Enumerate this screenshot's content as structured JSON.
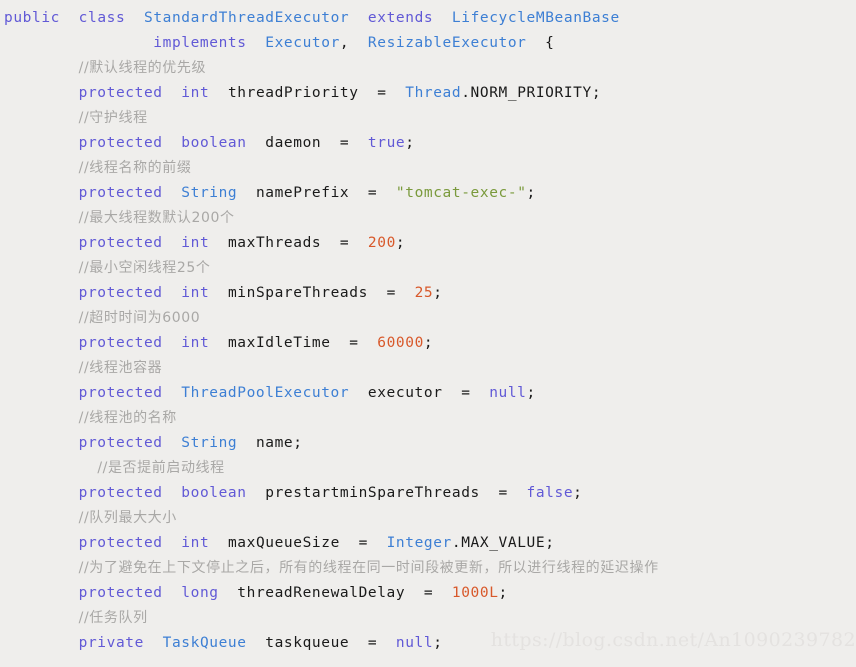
{
  "editor": {
    "background_color": "#efeeec",
    "language": "java",
    "colors": {
      "keyword": "#6159d6",
      "type": "#3d7fd4",
      "identifier": "#1a1a1a",
      "number": "#d8582a",
      "string": "#7a9a3c",
      "comment": "#a9a8a6"
    }
  },
  "watermark": {
    "text": "https://blog.csdn.net/An1090239782"
  },
  "code": {
    "lines": [
      {
        "id": "line-1",
        "tokens": [
          {
            "t": "public",
            "c": "kw"
          },
          {
            "t": "  ",
            "c": "punc"
          },
          {
            "t": "class",
            "c": "kw"
          },
          {
            "t": "  ",
            "c": "punc"
          },
          {
            "t": "StandardThreadExecutor",
            "c": "type"
          },
          {
            "t": "  ",
            "c": "punc"
          },
          {
            "t": "extends",
            "c": "kw"
          },
          {
            "t": "  ",
            "c": "punc"
          },
          {
            "t": "LifecycleMBeanBase",
            "c": "type"
          }
        ]
      },
      {
        "id": "line-2",
        "tokens": [
          {
            "t": "                ",
            "c": "punc"
          },
          {
            "t": "implements",
            "c": "kw"
          },
          {
            "t": "  ",
            "c": "punc"
          },
          {
            "t": "Executor",
            "c": "type"
          },
          {
            "t": ",  ",
            "c": "punc"
          },
          {
            "t": "ResizableExecutor",
            "c": "type"
          },
          {
            "t": "  {",
            "c": "punc"
          }
        ]
      },
      {
        "id": "line-3",
        "tokens": [
          {
            "t": "        ",
            "c": "punc"
          },
          {
            "t": "//默认线程的优先级",
            "c": "cmt"
          }
        ]
      },
      {
        "id": "line-4",
        "tokens": [
          {
            "t": "        ",
            "c": "punc"
          },
          {
            "t": "protected",
            "c": "kw"
          },
          {
            "t": "  ",
            "c": "punc"
          },
          {
            "t": "int",
            "c": "kw"
          },
          {
            "t": "  ",
            "c": "punc"
          },
          {
            "t": "threadPriority",
            "c": "id"
          },
          {
            "t": "  =  ",
            "c": "punc"
          },
          {
            "t": "Thread",
            "c": "type"
          },
          {
            "t": ".NORM_PRIORITY;",
            "c": "id"
          }
        ]
      },
      {
        "id": "line-5",
        "tokens": [
          {
            "t": "        ",
            "c": "punc"
          },
          {
            "t": "//守护线程",
            "c": "cmt"
          }
        ]
      },
      {
        "id": "line-6",
        "tokens": [
          {
            "t": "        ",
            "c": "punc"
          },
          {
            "t": "protected",
            "c": "kw"
          },
          {
            "t": "  ",
            "c": "punc"
          },
          {
            "t": "boolean",
            "c": "kw"
          },
          {
            "t": "  ",
            "c": "punc"
          },
          {
            "t": "daemon",
            "c": "id"
          },
          {
            "t": "  =  ",
            "c": "punc"
          },
          {
            "t": "true",
            "c": "kw"
          },
          {
            "t": ";",
            "c": "punc"
          }
        ]
      },
      {
        "id": "line-7",
        "tokens": [
          {
            "t": "        ",
            "c": "punc"
          },
          {
            "t": "//线程名称的前缀",
            "c": "cmt"
          }
        ]
      },
      {
        "id": "line-8",
        "tokens": [
          {
            "t": "        ",
            "c": "punc"
          },
          {
            "t": "protected",
            "c": "kw"
          },
          {
            "t": "  ",
            "c": "punc"
          },
          {
            "t": "String",
            "c": "type"
          },
          {
            "t": "  ",
            "c": "punc"
          },
          {
            "t": "namePrefix",
            "c": "id"
          },
          {
            "t": "  =  ",
            "c": "punc"
          },
          {
            "t": "\"tomcat-exec-\"",
            "c": "str"
          },
          {
            "t": ";",
            "c": "punc"
          }
        ]
      },
      {
        "id": "line-9",
        "tokens": [
          {
            "t": "        ",
            "c": "punc"
          },
          {
            "t": "//最大线程数默认200个",
            "c": "cmt"
          }
        ]
      },
      {
        "id": "line-10",
        "tokens": [
          {
            "t": "        ",
            "c": "punc"
          },
          {
            "t": "protected",
            "c": "kw"
          },
          {
            "t": "  ",
            "c": "punc"
          },
          {
            "t": "int",
            "c": "kw"
          },
          {
            "t": "  ",
            "c": "punc"
          },
          {
            "t": "maxThreads",
            "c": "id"
          },
          {
            "t": "  =  ",
            "c": "punc"
          },
          {
            "t": "200",
            "c": "num"
          },
          {
            "t": ";",
            "c": "punc"
          }
        ]
      },
      {
        "id": "line-11",
        "tokens": [
          {
            "t": "        ",
            "c": "punc"
          },
          {
            "t": "//最小空闲线程25个",
            "c": "cmt"
          }
        ]
      },
      {
        "id": "line-12",
        "tokens": [
          {
            "t": "        ",
            "c": "punc"
          },
          {
            "t": "protected",
            "c": "kw"
          },
          {
            "t": "  ",
            "c": "punc"
          },
          {
            "t": "int",
            "c": "kw"
          },
          {
            "t": "  ",
            "c": "punc"
          },
          {
            "t": "minSpareThreads",
            "c": "id"
          },
          {
            "t": "  =  ",
            "c": "punc"
          },
          {
            "t": "25",
            "c": "num"
          },
          {
            "t": ";",
            "c": "punc"
          }
        ]
      },
      {
        "id": "line-13",
        "tokens": [
          {
            "t": "        ",
            "c": "punc"
          },
          {
            "t": "//超时时间为6000",
            "c": "cmt"
          }
        ]
      },
      {
        "id": "line-14",
        "tokens": [
          {
            "t": "        ",
            "c": "punc"
          },
          {
            "t": "protected",
            "c": "kw"
          },
          {
            "t": "  ",
            "c": "punc"
          },
          {
            "t": "int",
            "c": "kw"
          },
          {
            "t": "  ",
            "c": "punc"
          },
          {
            "t": "maxIdleTime",
            "c": "id"
          },
          {
            "t": "  =  ",
            "c": "punc"
          },
          {
            "t": "60000",
            "c": "num"
          },
          {
            "t": ";",
            "c": "punc"
          }
        ]
      },
      {
        "id": "line-15",
        "tokens": [
          {
            "t": "        ",
            "c": "punc"
          },
          {
            "t": "//线程池容器",
            "c": "cmt"
          }
        ]
      },
      {
        "id": "line-16",
        "tokens": [
          {
            "t": "        ",
            "c": "punc"
          },
          {
            "t": "protected",
            "c": "kw"
          },
          {
            "t": "  ",
            "c": "punc"
          },
          {
            "t": "ThreadPoolExecutor",
            "c": "type"
          },
          {
            "t": "  ",
            "c": "punc"
          },
          {
            "t": "executor",
            "c": "id"
          },
          {
            "t": "  =  ",
            "c": "punc"
          },
          {
            "t": "null",
            "c": "kw"
          },
          {
            "t": ";",
            "c": "punc"
          }
        ]
      },
      {
        "id": "line-17",
        "tokens": [
          {
            "t": "        ",
            "c": "punc"
          },
          {
            "t": "//线程池的名称",
            "c": "cmt"
          }
        ]
      },
      {
        "id": "line-18",
        "tokens": [
          {
            "t": "        ",
            "c": "punc"
          },
          {
            "t": "protected",
            "c": "kw"
          },
          {
            "t": "  ",
            "c": "punc"
          },
          {
            "t": "String",
            "c": "type"
          },
          {
            "t": "  ",
            "c": "punc"
          },
          {
            "t": "name",
            "c": "id"
          },
          {
            "t": ";",
            "c": "punc"
          }
        ]
      },
      {
        "id": "line-19",
        "tokens": [
          {
            "t": "          ",
            "c": "punc"
          },
          {
            "t": "//是否提前启动线程",
            "c": "cmt"
          }
        ]
      },
      {
        "id": "line-20",
        "tokens": [
          {
            "t": "        ",
            "c": "punc"
          },
          {
            "t": "protected",
            "c": "kw"
          },
          {
            "t": "  ",
            "c": "punc"
          },
          {
            "t": "boolean",
            "c": "kw"
          },
          {
            "t": "  ",
            "c": "punc"
          },
          {
            "t": "prestartminSpareThreads",
            "c": "id"
          },
          {
            "t": "  =  ",
            "c": "punc"
          },
          {
            "t": "false",
            "c": "kw"
          },
          {
            "t": ";",
            "c": "punc"
          }
        ]
      },
      {
        "id": "line-21",
        "tokens": [
          {
            "t": "        ",
            "c": "punc"
          },
          {
            "t": "//队列最大大小",
            "c": "cmt"
          }
        ]
      },
      {
        "id": "line-22",
        "tokens": [
          {
            "t": "        ",
            "c": "punc"
          },
          {
            "t": "protected",
            "c": "kw"
          },
          {
            "t": "  ",
            "c": "punc"
          },
          {
            "t": "int",
            "c": "kw"
          },
          {
            "t": "  ",
            "c": "punc"
          },
          {
            "t": "maxQueueSize",
            "c": "id"
          },
          {
            "t": "  =  ",
            "c": "punc"
          },
          {
            "t": "Integer",
            "c": "type"
          },
          {
            "t": ".MAX_VALUE;",
            "c": "id"
          }
        ]
      },
      {
        "id": "line-23",
        "tokens": [
          {
            "t": "        ",
            "c": "punc"
          },
          {
            "t": "//为了避免在上下文停止之后，所有的线程在同一时间段被更新，所以进行线程的延迟操作",
            "c": "cmt"
          }
        ]
      },
      {
        "id": "line-24",
        "tokens": [
          {
            "t": "        ",
            "c": "punc"
          },
          {
            "t": "protected",
            "c": "kw"
          },
          {
            "t": "  ",
            "c": "punc"
          },
          {
            "t": "long",
            "c": "kw"
          },
          {
            "t": "  ",
            "c": "punc"
          },
          {
            "t": "threadRenewalDelay",
            "c": "id"
          },
          {
            "t": "  =  ",
            "c": "punc"
          },
          {
            "t": "1000L",
            "c": "num"
          },
          {
            "t": ";",
            "c": "punc"
          }
        ]
      },
      {
        "id": "line-25",
        "tokens": [
          {
            "t": "        ",
            "c": "punc"
          },
          {
            "t": "//任务队列",
            "c": "cmt"
          }
        ]
      },
      {
        "id": "line-26",
        "tokens": [
          {
            "t": "        ",
            "c": "punc"
          },
          {
            "t": "private",
            "c": "kw"
          },
          {
            "t": "  ",
            "c": "punc"
          },
          {
            "t": "TaskQueue",
            "c": "type"
          },
          {
            "t": "  ",
            "c": "punc"
          },
          {
            "t": "taskqueue",
            "c": "id"
          },
          {
            "t": "  =  ",
            "c": "punc"
          },
          {
            "t": "null",
            "c": "kw"
          },
          {
            "t": ";",
            "c": "punc"
          }
        ]
      }
    ]
  }
}
